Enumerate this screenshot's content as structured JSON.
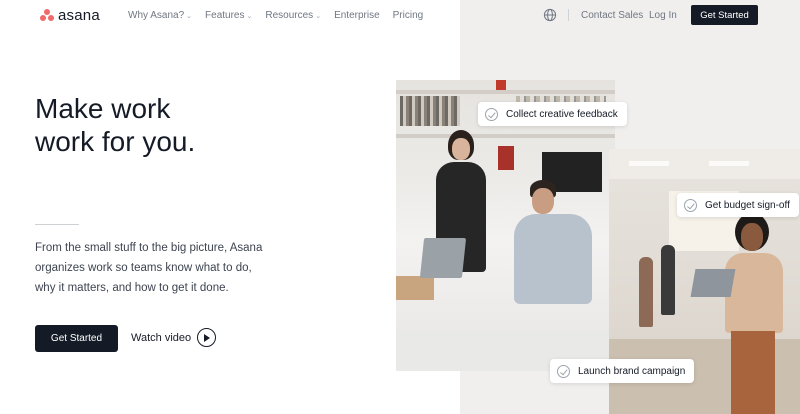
{
  "brand": {
    "name": "asana",
    "accent": "#f06a6a"
  },
  "nav": {
    "items": [
      {
        "label": "Why Asana?",
        "dropdown": true
      },
      {
        "label": "Features",
        "dropdown": true
      },
      {
        "label": "Resources",
        "dropdown": true
      },
      {
        "label": "Enterprise",
        "dropdown": false
      },
      {
        "label": "Pricing",
        "dropdown": false
      }
    ],
    "globe_icon": "globe-icon",
    "contact_label": "Contact Sales",
    "login_label": "Log In",
    "cta_label": "Get Started"
  },
  "hero": {
    "headline_line1": "Make work",
    "headline_line2": "work for you.",
    "subtext": "From the small stuff to the big picture, Asana organizes work so teams know what to do, why it matters, and how to get it done.",
    "cta_label": "Get Started",
    "watch_label": "Watch video"
  },
  "tasks": [
    {
      "label": "Collect creative feedback"
    },
    {
      "label": "Get budget sign-off"
    },
    {
      "label": "Launch brand campaign"
    }
  ]
}
